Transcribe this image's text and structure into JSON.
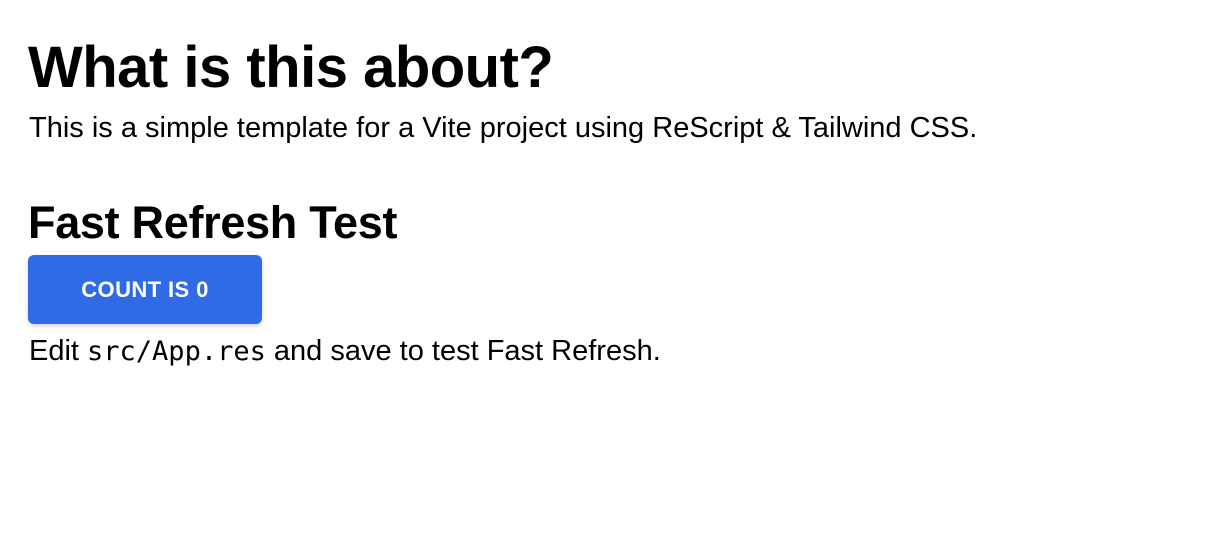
{
  "intro": {
    "heading": "What is this about?",
    "text": "This is a simple template for a Vite project using ReScript & Tailwind CSS."
  },
  "fast_refresh": {
    "heading": "Fast Refresh Test",
    "button_label": "Count is 0",
    "edit_prefix": "Edit ",
    "edit_code": "src/App.res",
    "edit_suffix": " and save to test Fast Refresh."
  },
  "colors": {
    "button_background": "#2f6be5",
    "button_text": "#ffffff",
    "page_background": "#ffffff",
    "text": "#000000"
  }
}
